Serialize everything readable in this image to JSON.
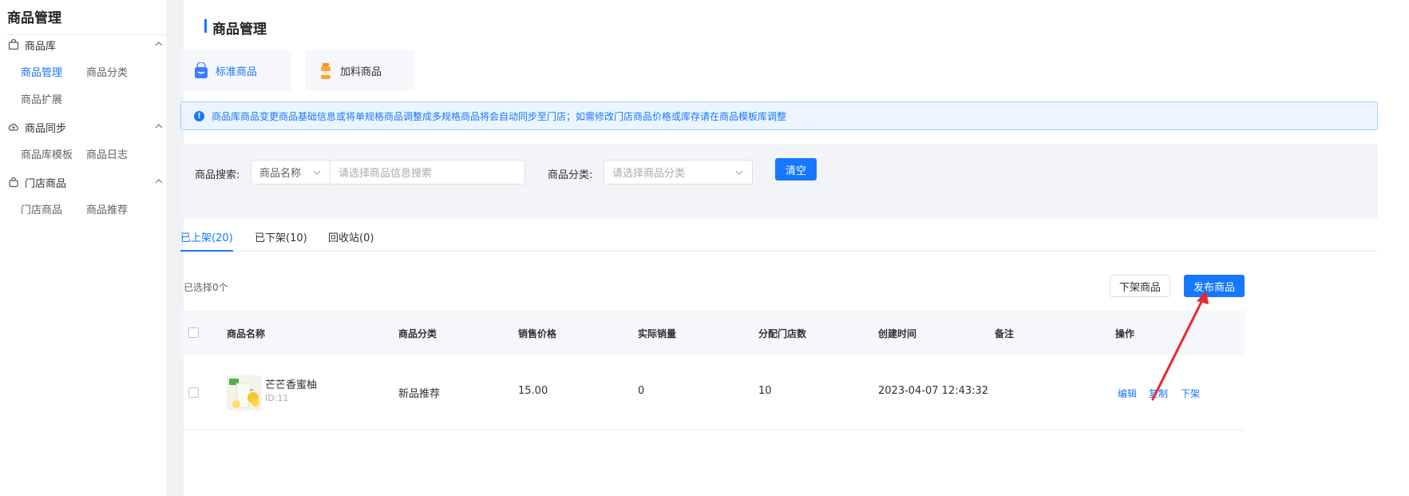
{
  "sidebar": {
    "title": "商品管理",
    "groups": [
      {
        "label": "商品库",
        "items": [
          "商品管理",
          "商品分类",
          "商品扩展"
        ]
      },
      {
        "label": "商品同步",
        "items": [
          "商品库模板",
          "商品日志"
        ]
      },
      {
        "label": "门店商品",
        "items": [
          "门店商品",
          "商品推荐"
        ]
      }
    ]
  },
  "main": {
    "title": "商品管理",
    "type_cards": [
      {
        "label": "标准商品"
      },
      {
        "label": "加料商品"
      }
    ],
    "alert": "商品库商品变更商品基础信息或将单规格商品调整成多规格商品将会自动同步至门店；如需修改门店商品价格或库存请在商品模板库调整",
    "filter": {
      "search_label": "商品搜索:",
      "search_field_value": "商品名称",
      "search_placeholder": "请选择商品信息搜索",
      "category_label": "商品分类:",
      "category_placeholder": "请选择商品分类",
      "clear_button": "清空"
    },
    "tabs": [
      "已上架(20)",
      "已下架(10)",
      "回收站(0)"
    ],
    "selected_count": "已选择0个",
    "actions": {
      "unlist_button": "下架商品",
      "publish_button": "发布商品"
    },
    "table": {
      "headers": [
        "商品名称",
        "商品分类",
        "销售价格",
        "实际销量",
        "分配门店数",
        "创建时间",
        "备注",
        "操作"
      ],
      "rows": [
        {
          "name": "芒芒香蜜柚",
          "id": "ID:11",
          "category": "新品推荐",
          "price": "15.00",
          "sales": "0",
          "stores": "10",
          "created": "2023-04-07 12:43:32",
          "note": "",
          "ops": [
            "编辑",
            "复制",
            "下架"
          ]
        }
      ]
    }
  },
  "colors": {
    "primary": "#1677ff",
    "annotation_arrow": "#e8282b"
  }
}
